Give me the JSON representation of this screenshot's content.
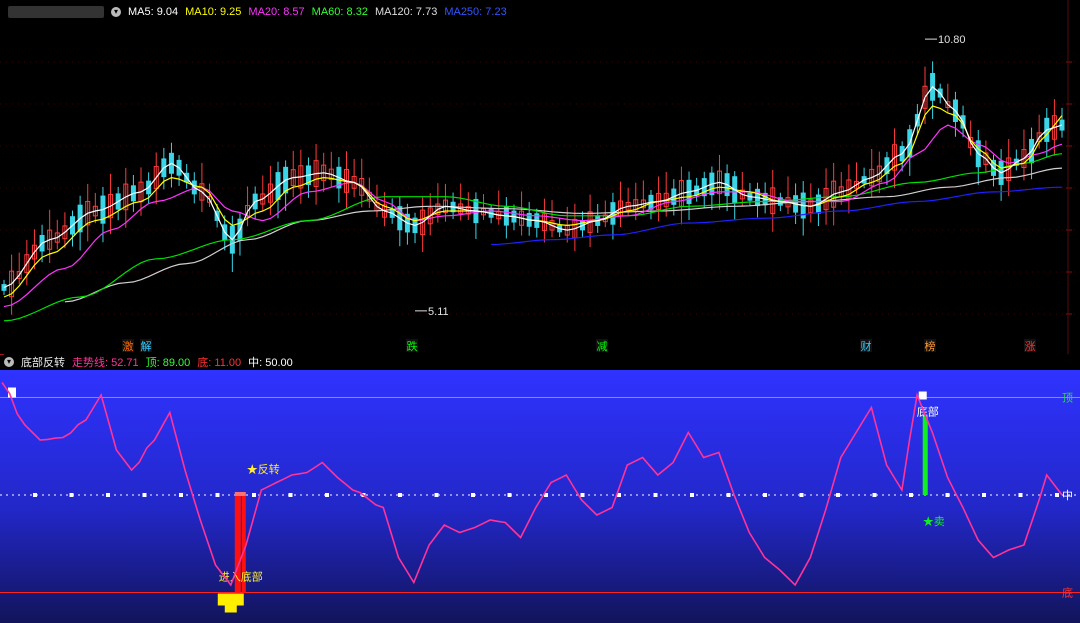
{
  "upper_legend": {
    "ma5": "MA5: 9.04",
    "ma10": "MA10: 9.25",
    "ma20": "MA20: 8.57",
    "ma60": "MA60: 8.32",
    "ma120": "MA120: 7.73",
    "ma250": "MA250: 7.23",
    "colors": {
      "ma5": "#ffffff",
      "ma10": "#ffff00",
      "ma20": "#ff33ff",
      "ma60": "#00e000",
      "ma120": "#d0d0d0",
      "ma250": "#2020ff"
    }
  },
  "upper_annotations": {
    "high_label": "10.80",
    "low_label": "5.11"
  },
  "event_markers": [
    {
      "label": "激",
      "color": "#ff6600"
    },
    {
      "label": "解",
      "color": "#33ccff"
    },
    {
      "label": "跌",
      "color": "#00ff00"
    },
    {
      "label": "减",
      "color": "#00ff00"
    },
    {
      "label": "财",
      "color": "#33ccff"
    },
    {
      "label": "榜",
      "color": "#ff9933"
    },
    {
      "label": "涨",
      "color": "#ff3333"
    }
  ],
  "lower_legend": {
    "name": "底部反转",
    "trend": "走势线: 52.71",
    "top": "顶: 89.00",
    "bottom": "底: 11.00",
    "middle": "中: 50.00"
  },
  "lower_labels": {
    "reversal": "★反转",
    "enter_bottom": "进入底部",
    "bottom_tag": "底部",
    "sell": "★卖",
    "top_edge": "顶",
    "mid_edge": "中",
    "bottom_edge": "底"
  },
  "chart_data": [
    {
      "type": "line",
      "title": "",
      "xlabel": "",
      "ylabel": "",
      "x_count": 140,
      "ylim": [
        4.5,
        11.2
      ],
      "annotations": [
        {
          "label": "10.80",
          "x": 121,
          "y": 10.8
        },
        {
          "label": "5.11",
          "x": 54,
          "y": 5.11
        }
      ],
      "series": [
        {
          "name": "MA5",
          "color": "#ffffff",
          "anchors": [
            [
              0,
              5.6
            ],
            [
              6,
              6.6
            ],
            [
              12,
              7.2
            ],
            [
              18,
              7.6
            ],
            [
              22,
              8.2
            ],
            [
              26,
              7.6
            ],
            [
              30,
              6.6
            ],
            [
              33,
              7.4
            ],
            [
              38,
              7.9
            ],
            [
              42,
              8.0
            ],
            [
              46,
              7.8
            ],
            [
              50,
              7.2
            ],
            [
              54,
              6.9
            ],
            [
              58,
              7.3
            ],
            [
              62,
              7.2
            ],
            [
              66,
              7.1
            ],
            [
              70,
              7.0
            ],
            [
              74,
              6.8
            ],
            [
              78,
              7.0
            ],
            [
              82,
              7.3
            ],
            [
              86,
              7.4
            ],
            [
              90,
              7.6
            ],
            [
              94,
              7.8
            ],
            [
              98,
              7.5
            ],
            [
              102,
              7.4
            ],
            [
              106,
              7.3
            ],
            [
              110,
              7.6
            ],
            [
              114,
              7.9
            ],
            [
              118,
              8.4
            ],
            [
              122,
              9.8
            ],
            [
              125,
              9.3
            ],
            [
              128,
              8.4
            ],
            [
              131,
              8.0
            ],
            [
              134,
              8.3
            ],
            [
              137,
              8.9
            ],
            [
              139,
              9.0
            ]
          ]
        },
        {
          "name": "MA10",
          "color": "#ffff00",
          "anchors": [
            [
              0,
              5.4
            ],
            [
              6,
              6.3
            ],
            [
              12,
              7.0
            ],
            [
              18,
              7.4
            ],
            [
              22,
              7.9
            ],
            [
              26,
              7.7
            ],
            [
              30,
              6.9
            ],
            [
              34,
              7.2
            ],
            [
              38,
              7.7
            ],
            [
              42,
              7.9
            ],
            [
              46,
              7.8
            ],
            [
              50,
              7.3
            ],
            [
              54,
              7.0
            ],
            [
              58,
              7.2
            ],
            [
              62,
              7.2
            ],
            [
              66,
              7.1
            ],
            [
              70,
              7.0
            ],
            [
              74,
              6.9
            ],
            [
              78,
              7.0
            ],
            [
              82,
              7.2
            ],
            [
              86,
              7.4
            ],
            [
              90,
              7.5
            ],
            [
              94,
              7.7
            ],
            [
              98,
              7.6
            ],
            [
              102,
              7.4
            ],
            [
              106,
              7.3
            ],
            [
              110,
              7.5
            ],
            [
              114,
              7.8
            ],
            [
              118,
              8.2
            ],
            [
              122,
              9.4
            ],
            [
              125,
              9.2
            ],
            [
              128,
              8.5
            ],
            [
              131,
              8.1
            ],
            [
              134,
              8.2
            ],
            [
              137,
              8.8
            ],
            [
              139,
              9.2
            ]
          ]
        },
        {
          "name": "MA20",
          "color": "#ff33ff",
          "anchors": [
            [
              0,
              5.2
            ],
            [
              8,
              6.0
            ],
            [
              14,
              6.8
            ],
            [
              20,
              7.4
            ],
            [
              26,
              7.7
            ],
            [
              30,
              7.2
            ],
            [
              34,
              7.0
            ],
            [
              40,
              7.6
            ],
            [
              46,
              7.8
            ],
            [
              50,
              7.4
            ],
            [
              54,
              7.0
            ],
            [
              58,
              7.1
            ],
            [
              64,
              7.2
            ],
            [
              70,
              7.1
            ],
            [
              76,
              7.0
            ],
            [
              82,
              7.1
            ],
            [
              88,
              7.4
            ],
            [
              94,
              7.6
            ],
            [
              98,
              7.6
            ],
            [
              104,
              7.4
            ],
            [
              110,
              7.4
            ],
            [
              116,
              7.8
            ],
            [
              120,
              8.4
            ],
            [
              124,
              9.0
            ],
            [
              128,
              8.6
            ],
            [
              132,
              8.2
            ],
            [
              136,
              8.4
            ],
            [
              139,
              8.6
            ]
          ]
        },
        {
          "name": "MA60",
          "color": "#00e000",
          "anchors": [
            [
              0,
              4.9
            ],
            [
              10,
              5.4
            ],
            [
              20,
              6.2
            ],
            [
              30,
              6.6
            ],
            [
              40,
              7.0
            ],
            [
              50,
              7.5
            ],
            [
              58,
              7.5
            ],
            [
              66,
              7.3
            ],
            [
              74,
              7.1
            ],
            [
              82,
              7.1
            ],
            [
              90,
              7.3
            ],
            [
              100,
              7.4
            ],
            [
              110,
              7.5
            ],
            [
              120,
              7.8
            ],
            [
              128,
              8.0
            ],
            [
              134,
              8.2
            ],
            [
              139,
              8.4
            ]
          ]
        },
        {
          "name": "MA120",
          "color": "#d0d0d0",
          "anchors": [
            [
              8,
              5.3
            ],
            [
              16,
              5.7
            ],
            [
              24,
              6.1
            ],
            [
              32,
              6.6
            ],
            [
              40,
              7.0
            ],
            [
              48,
              7.2
            ],
            [
              56,
              7.3
            ],
            [
              66,
              7.25
            ],
            [
              76,
              7.15
            ],
            [
              86,
              7.2
            ],
            [
              96,
              7.3
            ],
            [
              106,
              7.4
            ],
            [
              116,
              7.5
            ],
            [
              124,
              7.7
            ],
            [
              132,
              7.9
            ],
            [
              139,
              8.1
            ]
          ]
        },
        {
          "name": "MA250",
          "color": "#2020ff",
          "anchors": [
            [
              64,
              6.5
            ],
            [
              72,
              6.6
            ],
            [
              80,
              6.7
            ],
            [
              90,
              6.95
            ],
            [
              100,
              7.05
            ],
            [
              110,
              7.2
            ],
            [
              120,
              7.4
            ],
            [
              130,
              7.6
            ],
            [
              139,
              7.7
            ]
          ]
        }
      ]
    },
    {
      "type": "line",
      "title": "",
      "xlabel": "",
      "ylabel": "",
      "x_count": 140,
      "ylim": [
        0,
        100
      ],
      "reference_lines": [
        {
          "label": "顶",
          "value": 89
        },
        {
          "label": "中",
          "value": 50
        },
        {
          "label": "底",
          "value": 11
        }
      ],
      "series": [
        {
          "name": "走势线",
          "color": "#ff3399",
          "anchors": [
            [
              0,
              95
            ],
            [
              3,
              78
            ],
            [
              5,
              72
            ],
            [
              8,
              73
            ],
            [
              11,
              80
            ],
            [
              13,
              90
            ],
            [
              15,
              68
            ],
            [
              17,
              60
            ],
            [
              20,
              72
            ],
            [
              22,
              83
            ],
            [
              24,
              60
            ],
            [
              26,
              40
            ],
            [
              28,
              22
            ],
            [
              30,
              14
            ],
            [
              32,
              30
            ],
            [
              34,
              52
            ],
            [
              36,
              55
            ],
            [
              38,
              58
            ],
            [
              40,
              59
            ],
            [
              42,
              63
            ],
            [
              44,
              57
            ],
            [
              46,
              52
            ],
            [
              50,
              45
            ],
            [
              52,
              25
            ],
            [
              54,
              15
            ],
            [
              56,
              30
            ],
            [
              58,
              38
            ],
            [
              60,
              35
            ],
            [
              62,
              37
            ],
            [
              64,
              40
            ],
            [
              66,
              39
            ],
            [
              68,
              33
            ],
            [
              70,
              45
            ],
            [
              72,
              55
            ],
            [
              74,
              58
            ],
            [
              76,
              48
            ],
            [
              78,
              42
            ],
            [
              80,
              45
            ],
            [
              82,
              62
            ],
            [
              84,
              65
            ],
            [
              86,
              58
            ],
            [
              88,
              63
            ],
            [
              90,
              75
            ],
            [
              92,
              65
            ],
            [
              94,
              67
            ],
            [
              96,
              50
            ],
            [
              98,
              35
            ],
            [
              100,
              25
            ],
            [
              102,
              20
            ],
            [
              104,
              14
            ],
            [
              106,
              25
            ],
            [
              108,
              44
            ],
            [
              110,
              65
            ],
            [
              112,
              75
            ],
            [
              114,
              85
            ],
            [
              116,
              62
            ],
            [
              118,
              52
            ],
            [
              119,
              72
            ],
            [
              120,
              90
            ],
            [
              122,
              75
            ],
            [
              124,
              57
            ],
            [
              126,
              45
            ],
            [
              128,
              32
            ],
            [
              130,
              25
            ],
            [
              132,
              28
            ],
            [
              134,
              30
            ],
            [
              136,
              48
            ],
            [
              137,
              58
            ],
            [
              138,
              54
            ],
            [
              139,
              50
            ]
          ]
        }
      ],
      "signals": [
        {
          "label": "进入底部",
          "x": 30
        },
        {
          "label": "★反转",
          "x": 32
        },
        {
          "label": "底部",
          "x": 121
        },
        {
          "label": "★卖",
          "x": 121
        }
      ]
    }
  ]
}
